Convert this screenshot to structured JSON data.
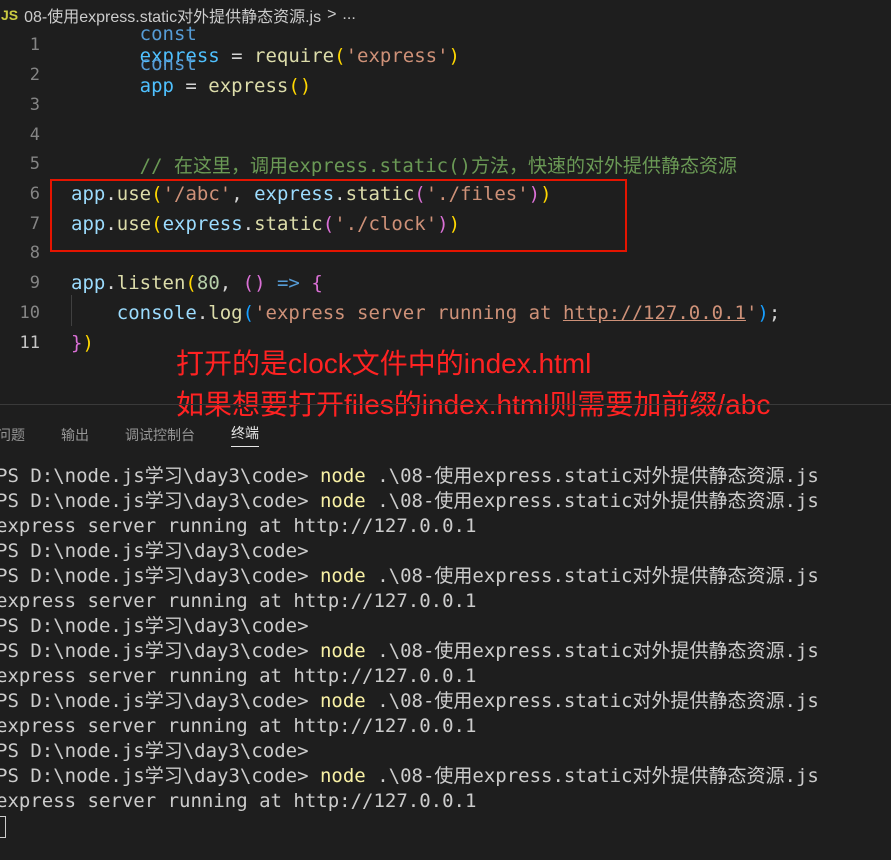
{
  "breadcrumb": {
    "lang_badge": "JS",
    "file": "08-使用express.static对外提供静态资源.js",
    "sep": ">",
    "more": "..."
  },
  "editor": {
    "line_numbers": [
      "1",
      "2",
      "3",
      "4",
      "5",
      "6",
      "7",
      "8",
      "9",
      "10",
      "11"
    ],
    "line1": {
      "kw": "const",
      "name": "express",
      "eq": " = ",
      "fn": "require",
      "p1": "(",
      "str": "'express'",
      "p2": ")"
    },
    "line2": {
      "kw": "const",
      "name": "app",
      "eq": " = ",
      "fn": "express",
      "parens": "()"
    },
    "line5": {
      "comment": "// 在这里，调用express.static()方法，快速的对外提供静态资源"
    },
    "line6": {
      "obj": "app",
      "dot": ".",
      "fn": "use",
      "p1": "(",
      "str1": "'/abc'",
      "comma": ", ",
      "obj2": "express",
      "dot2": ".",
      "fn2": "static",
      "p2": "(",
      "str2": "'./files'",
      "p3": ")",
      "p4": ")"
    },
    "line7": {
      "obj": "app",
      "dot": ".",
      "fn": "use",
      "p1": "(",
      "obj2": "express",
      "dot2": ".",
      "fn2": "static",
      "p2": "(",
      "str": "'./clock'",
      "p3": ")",
      "p4": ")"
    },
    "line9": {
      "obj": "app",
      "dot": ".",
      "fn": "listen",
      "p1": "(",
      "num": "80",
      "comma": ", ",
      "p2": "()",
      "arrow": " => ",
      "brace": "{"
    },
    "line10": {
      "obj": "console",
      "dot": ".",
      "fn": "log",
      "p1": "(",
      "str_a": "'express server running at ",
      "url": "http://127.0.0.1",
      "str_b": "'",
      "p2": ")",
      "semi": ";"
    },
    "line11": {
      "brace": "}",
      "paren": ")"
    }
  },
  "annotation": {
    "line1": "打开的是clock文件中的index.html",
    "line2": "如果想要打开files的index.html则需要加前缀/abc"
  },
  "panel": {
    "tabs": [
      "问题",
      "输出",
      "调试控制台",
      "终端"
    ],
    "active_tab": "终端"
  },
  "terminal": {
    "prompt": "PS D:\\node.js学习\\day3\\code> ",
    "prompt_only": "PS D:\\node.js学习\\day3\\code>",
    "cmd": "node",
    "arg": " .\\08-使用express.static对外提供静态资源.js",
    "output": "express server running at http://127.0.0.1"
  }
}
